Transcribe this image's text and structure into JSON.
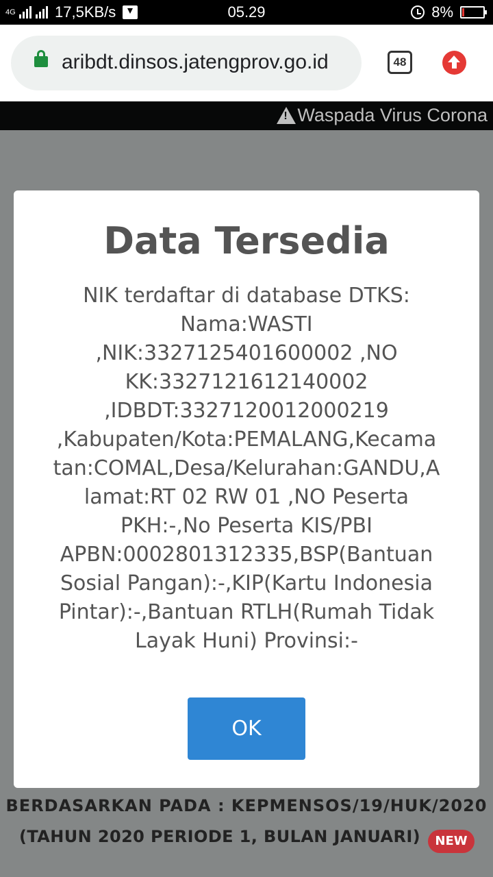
{
  "status_bar": {
    "network_type": "4G",
    "speed": "17,5KB/s",
    "time": "05.29",
    "battery": "8%",
    "battery_level": 0.08
  },
  "browser": {
    "url": "aribdt.dinsos.jatengprov.go.id",
    "tab_count": "48"
  },
  "marquee": {
    "text": "Waspada Virus Corona"
  },
  "dialog": {
    "title": "Data Tersedia",
    "lines": [
      "NIK terdaftar di database DTKS:",
      "Nama:WASTI",
      ",NIK:3327125401600002 ,NO",
      "KK:3327121612140002",
      ",IDBDT:3327120012000219",
      ",Kabupaten/Kota:PEMALANG,Kecama",
      "tan:COMAL,Desa/Kelurahan:GANDU,A",
      "lamat:RT 02 RW 01 ,NO Peserta",
      "PKH:-,No Peserta KIS/PBI",
      "APBN:0002801312335,BSP(Bantuan",
      "Sosial Pangan):-,KIP(Kartu Indonesia",
      "Pintar):-,Bantuan RTLH(Rumah Tidak",
      "Layak Huni) Provinsi:-"
    ],
    "ok_label": "OK"
  },
  "footer": {
    "line1": "BERDASARKAN PADA : KEPMENSOS/19/HUK/2020",
    "line2": "(TAHUN 2020 PERIODE 1, BULAN JANUARI)",
    "badge": "NEW"
  }
}
